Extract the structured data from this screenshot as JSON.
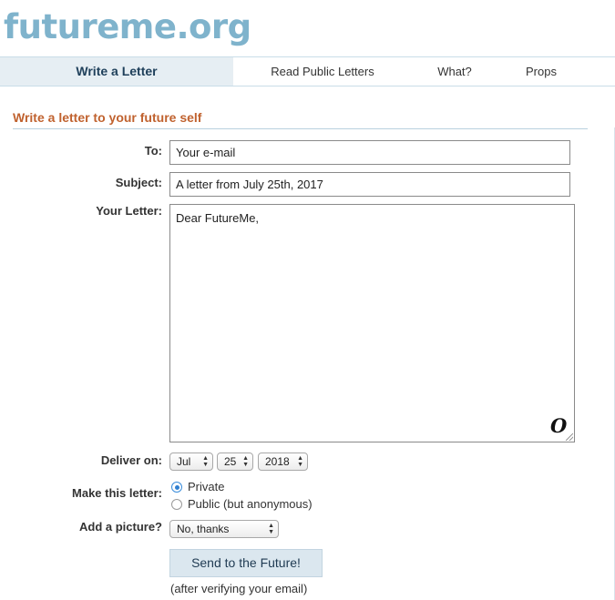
{
  "site": {
    "logo": "futureme.org"
  },
  "nav": {
    "tabs": [
      {
        "label": "Write a Letter",
        "active": true
      },
      {
        "label": "Read Public Letters",
        "active": false
      },
      {
        "label": "What?",
        "active": false
      },
      {
        "label": "Props",
        "active": false
      }
    ]
  },
  "form": {
    "title": "Write a letter to your future self",
    "to": {
      "label": "To:",
      "value": "Your e-mail"
    },
    "subject": {
      "label": "Subject:",
      "value": "A letter from July 25th, 2017"
    },
    "letter": {
      "label": "Your Letter:",
      "value": "Dear FutureMe,",
      "corner_glyph": "O"
    },
    "deliver": {
      "label": "Deliver on:",
      "month": "Jul",
      "day": "25",
      "year": "2018"
    },
    "privacy": {
      "label": "Make this letter:",
      "options": [
        {
          "label": "Private",
          "checked": true
        },
        {
          "label": "Public (but anonymous)",
          "checked": false
        }
      ]
    },
    "picture": {
      "label": "Add a picture?",
      "value": "No, thanks"
    },
    "submit": {
      "label": "Send to the Future!",
      "note": "(after verifying your email)"
    }
  },
  "colors": {
    "logo": "#7fb3cc",
    "title": "#c0622f",
    "active_tab_bg": "#e6eef3",
    "button_bg": "#dbe7ef"
  }
}
